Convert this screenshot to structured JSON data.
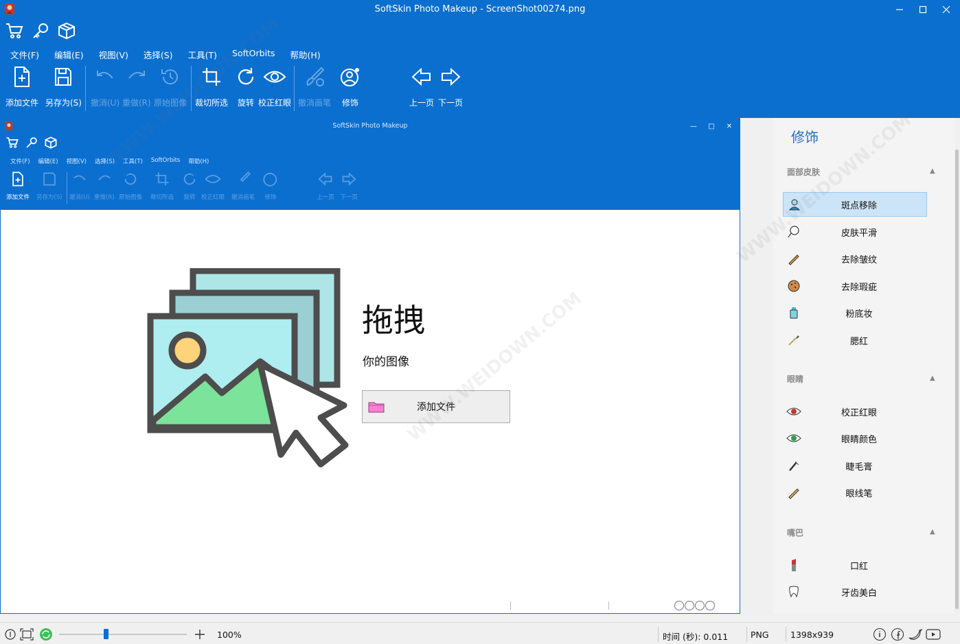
{
  "window": {
    "title": "SoftSkin Photo Makeup - ScreenShot00274.png",
    "min_icon": "minimize-icon",
    "max_icon": "maximize-icon",
    "close_icon": "close-icon"
  },
  "menu": [
    "文件(F)",
    "编辑(E)",
    "视图(V)",
    "选择(S)",
    "工具(T)",
    "SoftOrbits",
    "帮助(H)"
  ],
  "toolbar": {
    "add_file": "添加文件",
    "save_as": "另存为(S)",
    "undo": "撤消(U)",
    "redo": "重做(R)",
    "original": "原始图像",
    "crop": "裁切所选",
    "rotate": "旋转",
    "red_eye": "校正红眼",
    "undo_stroke": "撤消画笔",
    "retouch": "修饰",
    "prev": "上一页",
    "next": "下一页"
  },
  "inner": {
    "title": "SoftSkin Photo Makeup",
    "menu": [
      "文件(F)",
      "编辑(E)",
      "视图(V)",
      "选择(S)",
      "工具(T)",
      "SoftOrbits",
      "帮助(H)"
    ],
    "toolbar": [
      "添加文件",
      "另存为(S)",
      "撤消(U)",
      "重做(R)",
      "原始图像",
      "裁切所选",
      "旋转",
      "校正红眼",
      "撤消画笔",
      "修饰",
      "上一页",
      "下一页"
    ],
    "drag_title": "拖拽",
    "drag_sub": "你的图像",
    "add_file_button": "添加文件"
  },
  "panel": {
    "title": "修饰",
    "sections": [
      {
        "name": "面部皮肤",
        "items": [
          "斑点移除",
          "皮肤平滑",
          "去除皱纹",
          "去除瑕疵",
          "粉底妆",
          "腮红"
        ]
      },
      {
        "name": "眼睛",
        "items": [
          "校正红眼",
          "眼睛颜色",
          "睫毛膏",
          "眼线笔"
        ]
      },
      {
        "name": "嘴巴",
        "items": [
          "口红",
          "牙齿美白"
        ]
      }
    ],
    "selected_item": "斑点移除"
  },
  "status": {
    "zoom": "100%",
    "zoom_slider_fraction": 0.35,
    "time": "时间 (秒): 0.011",
    "format": "PNG",
    "dimensions": "1398x939"
  },
  "watermark": "WWW.WEIDOWN.COM",
  "colors": {
    "accent": "#0b6fd0",
    "panel_title": "#1f6ec7",
    "selected_bg": "#cce4f7"
  }
}
